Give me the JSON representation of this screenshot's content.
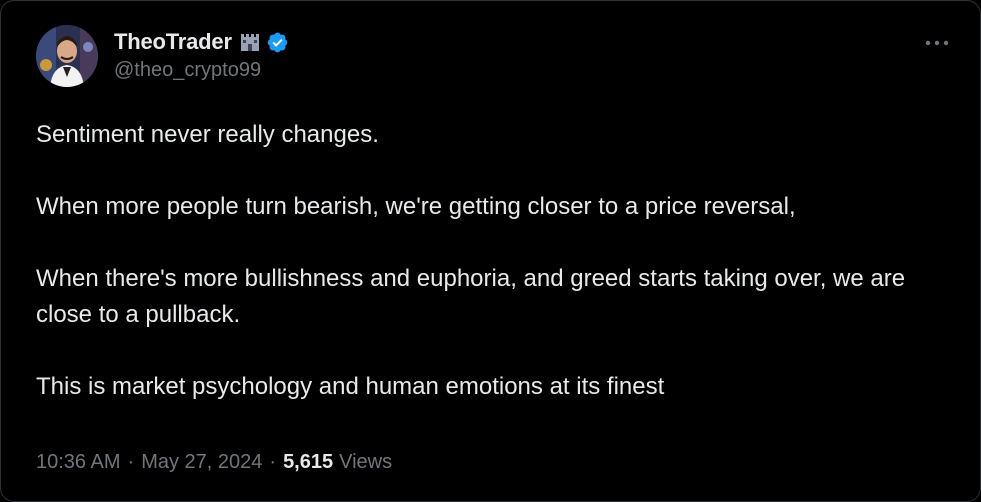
{
  "author": {
    "display_name": "TheoTrader",
    "handle": "@theo_crypto99",
    "badge_icon": "castle-emoji-icon",
    "verified_icon": "verified-badge-icon",
    "verified_color": "#1d9bf0"
  },
  "tweet": {
    "paragraphs": [
      "Sentiment never really changes.",
      "When more people turn bearish, we're getting closer to a price reversal,",
      "When there's more bullishness and euphoria, and greed starts taking over, we are close to a pullback.",
      "This is market psychology and human emotions at its finest"
    ]
  },
  "meta": {
    "time": "10:36 AM",
    "date": "May 27, 2024",
    "separator": "·",
    "views_count": "5,615",
    "views_label": "Views"
  },
  "colors": {
    "background": "#000000",
    "text": "#e7e9ea",
    "secondary_text": "#71767b",
    "border": "#2f3336"
  },
  "more_icon": "more-horizontal-icon"
}
